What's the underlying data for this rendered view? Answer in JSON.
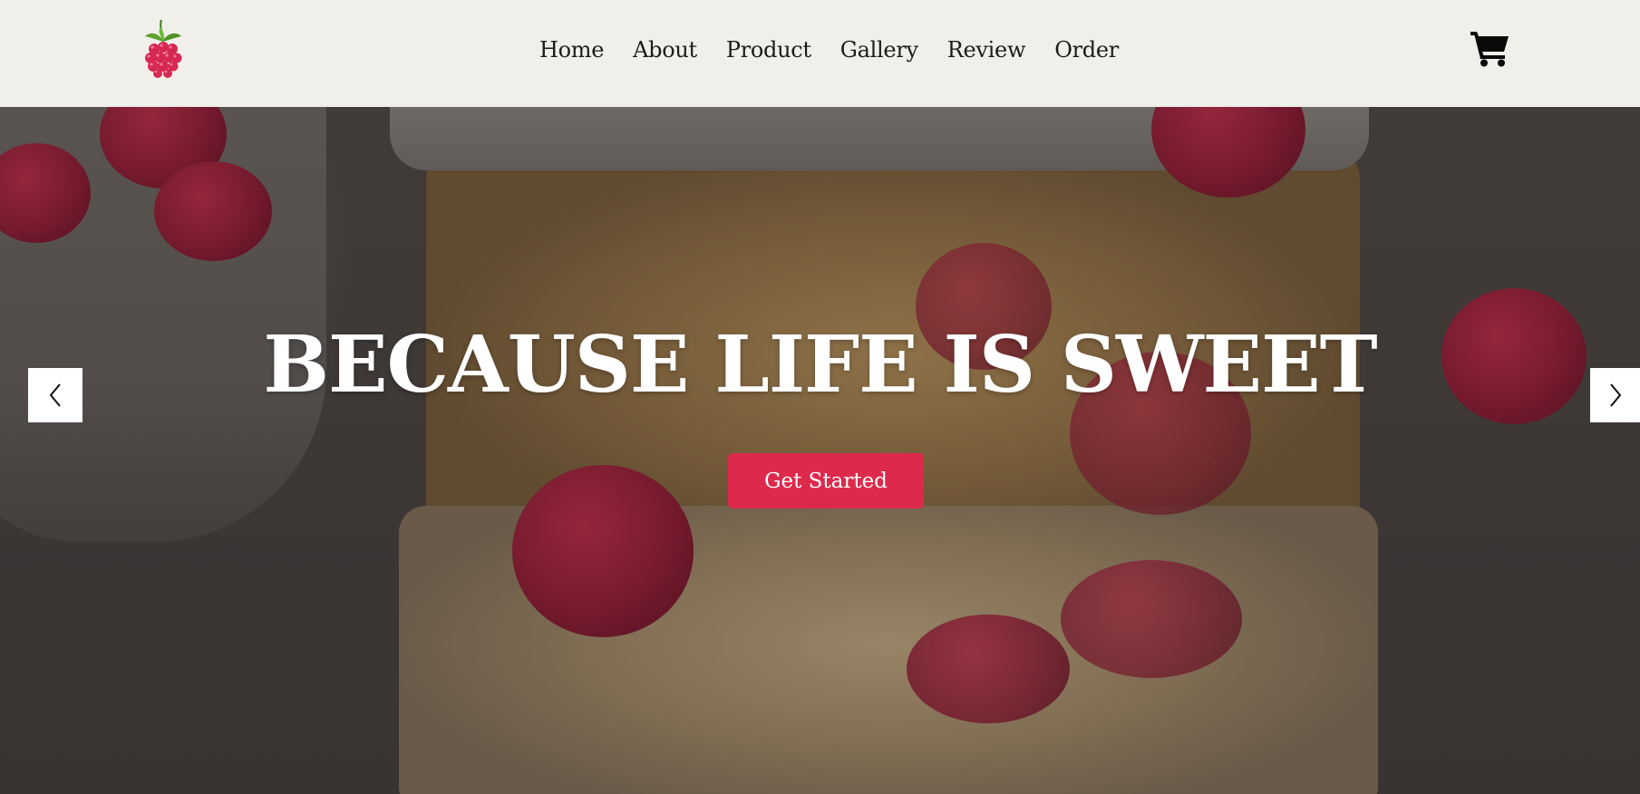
{
  "header": {
    "logo_icon": "raspberry-icon",
    "nav": [
      {
        "label": "Home"
      },
      {
        "label": "About"
      },
      {
        "label": "Product"
      },
      {
        "label": "Gallery"
      },
      {
        "label": "Review"
      },
      {
        "label": "Order"
      }
    ],
    "cart_icon": "shopping-cart-icon"
  },
  "hero": {
    "title": "BECAUSE LIFE IS SWEET",
    "cta_label": "Get Started",
    "prev_icon": "chevron-left-icon",
    "next_icon": "chevron-right-icon"
  },
  "colors": {
    "header_bg": "#f1efea",
    "accent": "#dd2a4c",
    "nav_text": "#1b1b1b",
    "hero_text": "#ffffff"
  }
}
